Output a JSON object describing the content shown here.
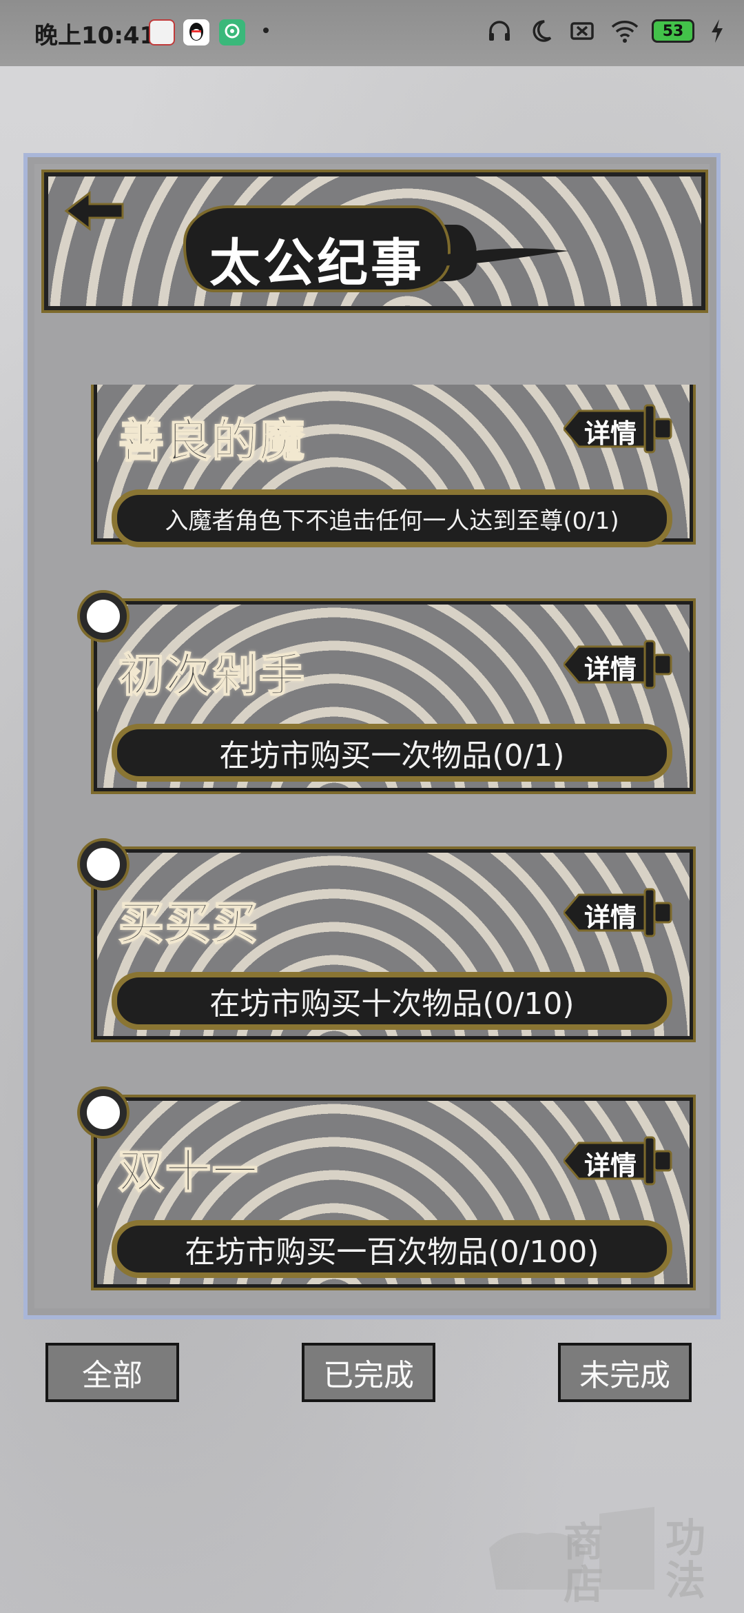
{
  "status_bar": {
    "time": "晚上10:41",
    "battery": "53",
    "app_icons": [
      "news-app-icon",
      "qq-icon",
      "location-app-icon"
    ],
    "right_icons": [
      "headphones-icon",
      "moon-icon",
      "sim-off-icon",
      "wifi-icon",
      "battery-icon",
      "charging-icon"
    ]
  },
  "header": {
    "title": "太公纪事",
    "back_icon": "arrow-left-icon"
  },
  "achievements": [
    {
      "title": "善良的魔",
      "detail_label": "详情",
      "description": "入魔者角色下不追击任何一人达到至尊(0/1)"
    },
    {
      "title": "初次剁手",
      "detail_label": "详情",
      "description": "在坊市购买一次物品(0/1)"
    },
    {
      "title": "买买买",
      "detail_label": "详情",
      "description": "在坊市购买十次物品(0/10)"
    },
    {
      "title": "双十一",
      "detail_label": "详情",
      "description": "在坊市购买一百次物品(0/100)"
    }
  ],
  "filters": {
    "all": "全部",
    "completed": "已完成",
    "incomplete": "未完成"
  },
  "watermark": {
    "shop": "商店",
    "skills": "功法"
  },
  "colors": {
    "gold_border": "#7d6a2c",
    "panel_border": "#a9b6d8",
    "dark": "#1f1f1f"
  }
}
